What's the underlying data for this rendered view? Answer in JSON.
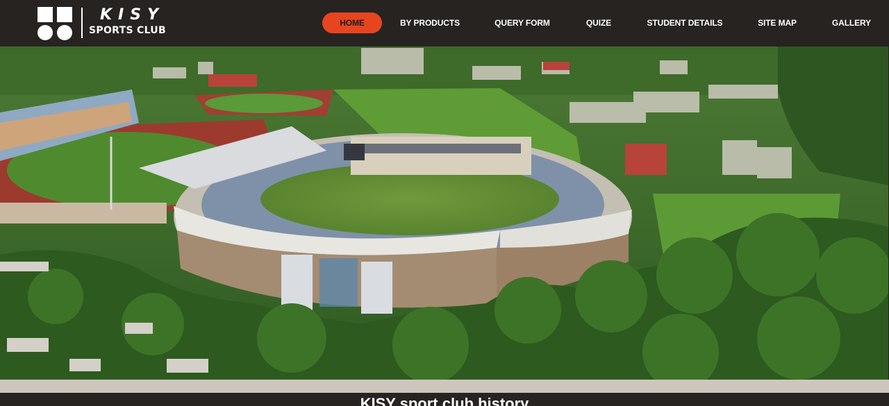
{
  "brand": {
    "name": "KISY",
    "subtitle": "SPORTS CLUB"
  },
  "nav": {
    "items": [
      {
        "label": "HOME",
        "active": true
      },
      {
        "label": "BY PRODUCTS",
        "active": false
      },
      {
        "label": "QUERY FORM",
        "active": false
      },
      {
        "label": "QUIZE",
        "active": false
      },
      {
        "label": "STUDENT DETAILS",
        "active": false
      },
      {
        "label": "SITE MAP",
        "active": false
      },
      {
        "label": "GALLERY",
        "active": false
      }
    ]
  },
  "section": {
    "title": "KISY sport club history"
  },
  "colors": {
    "header_bg": "#262321",
    "accent": "#e7451f",
    "strip": "#ccc6bc"
  }
}
